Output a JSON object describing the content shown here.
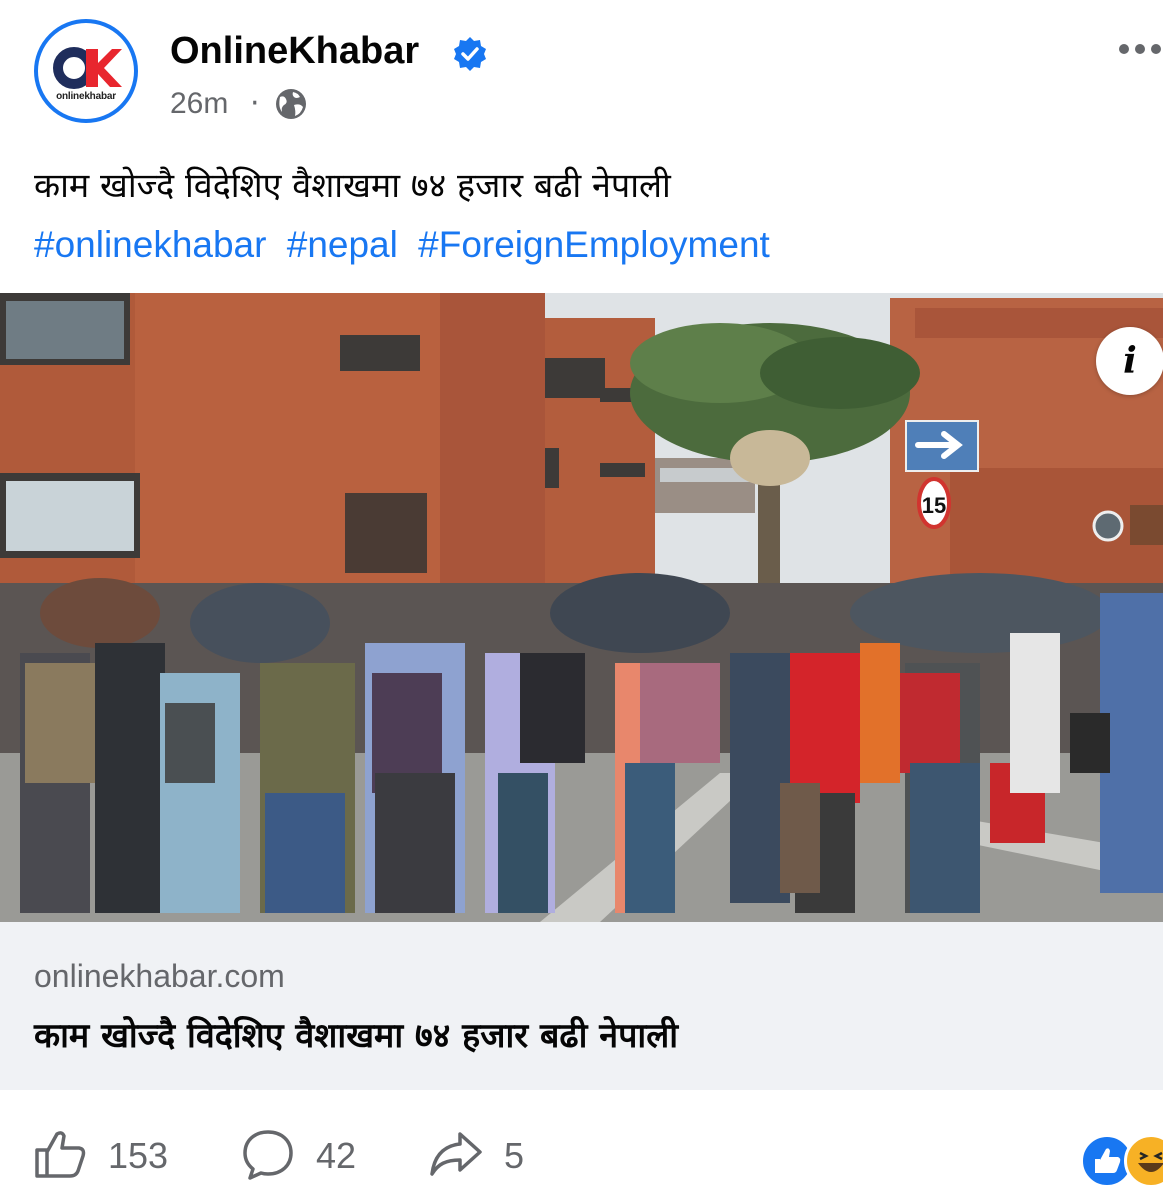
{
  "post": {
    "page_name": "OnlineKhabar",
    "avatar_logo_text": "onlinekhabar",
    "time": "26m",
    "separator": "·",
    "audience_icon": "globe-icon",
    "more_icon": "more-horizontal-icon",
    "caption": "काम खोज्दै विदेशिए वैशाखमा ७४ हजार बढी नेपाली",
    "hashtags": [
      "#onlinekhabar",
      "#nepal",
      "#ForeignEmployment"
    ]
  },
  "image": {
    "info_label": "i",
    "arrow_sign": "arrow-right-icon",
    "speed_sign": "15"
  },
  "link": {
    "domain": "onlinekhabar.com",
    "title": "काम खोज्दै विदेशिए वैशाखमा ७४ हजार बढी नेपाली"
  },
  "actions": {
    "like_count": "153",
    "comment_count": "42",
    "share_count": "5",
    "reactions": [
      "like-reaction-icon",
      "haha-reaction-icon"
    ]
  },
  "colors": {
    "brand_blue": "#1877f2",
    "secondary_text": "#65676b",
    "logo_red": "#e8262e",
    "logo_navy": "#1f2d5c"
  }
}
